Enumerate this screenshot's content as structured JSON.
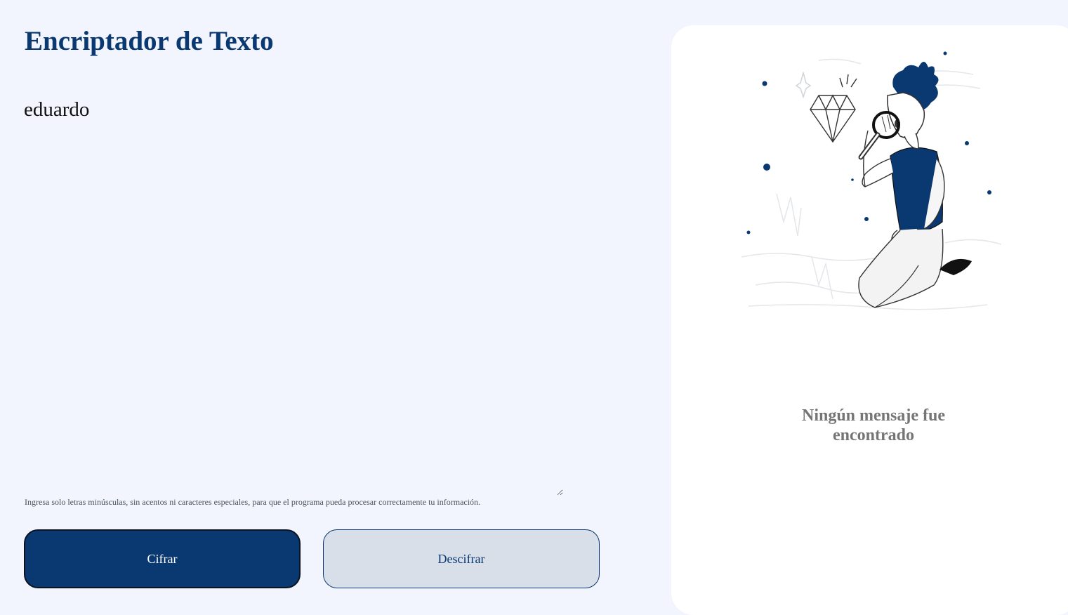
{
  "header": {
    "title": "Encriptador de Texto"
  },
  "input": {
    "value": "eduardo",
    "hint": "Ingresa solo letras minúsculas, sin acentos ni caracteres especiales, para que el programa pueda procesar correctamente tu información."
  },
  "buttons": {
    "encrypt_label": "Cifrar",
    "decrypt_label": "Descifrar"
  },
  "output": {
    "empty_message_line1": "Ningún mensaje fue",
    "empty_message_line2": "encontrado",
    "illustration_icon": "person-with-magnifier-icon"
  },
  "colors": {
    "primary": "#0a3871",
    "background": "#f2f5fd",
    "panel": "#ffffff",
    "muted_text": "#757575"
  }
}
